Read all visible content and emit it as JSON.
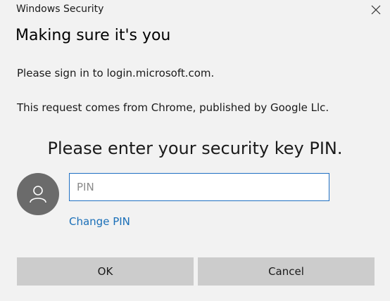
{
  "window": {
    "title": "Windows Security",
    "close_icon": "close-icon"
  },
  "content": {
    "heading": "Making sure it's you",
    "sign_in_text": "Please sign in to login.microsoft.com.",
    "request_text": "This request comes from Chrome, published by Google Llc.",
    "prompt": "Please enter your security key PIN."
  },
  "pin": {
    "placeholder": "PIN",
    "value": "",
    "change_link": "Change PIN"
  },
  "avatar": {
    "icon": "user-icon"
  },
  "buttons": {
    "ok": "OK",
    "cancel": "Cancel"
  },
  "colors": {
    "background": "#f2f2f2",
    "accent": "#1f6fc2",
    "link": "#1a6fb8",
    "button": "#cccccc",
    "avatar": "#6b6b6b"
  }
}
